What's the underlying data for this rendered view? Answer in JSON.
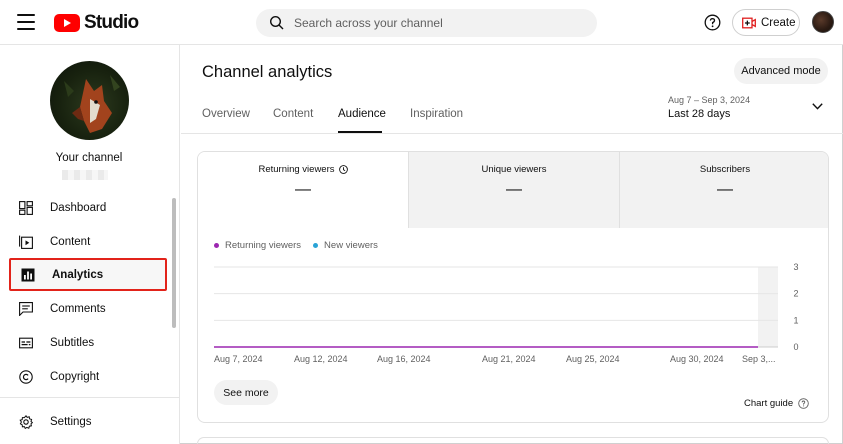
{
  "header": {
    "logo_text": "Studio",
    "search_placeholder": "Search across your channel",
    "create_label": "Create"
  },
  "sidebar": {
    "channel_label": "Your channel",
    "items": [
      {
        "label": "Dashboard",
        "icon": "dashboard-icon"
      },
      {
        "label": "Content",
        "icon": "content-icon"
      },
      {
        "label": "Analytics",
        "icon": "analytics-icon",
        "active": true
      },
      {
        "label": "Comments",
        "icon": "comments-icon"
      },
      {
        "label": "Subtitles",
        "icon": "subtitles-icon"
      },
      {
        "label": "Copyright",
        "icon": "copyright-icon"
      },
      {
        "label": "Settings",
        "icon": "settings-icon"
      }
    ]
  },
  "main": {
    "title": "Channel analytics",
    "advanced_mode_label": "Advanced mode",
    "tabs": [
      {
        "label": "Overview"
      },
      {
        "label": "Content"
      },
      {
        "label": "Audience",
        "active": true
      },
      {
        "label": "Inspiration"
      }
    ],
    "date_range": "Aug 7 – Sep 3, 2024",
    "date_label": "Last 28 days"
  },
  "metrics": [
    {
      "title": "Returning viewers",
      "value": "—",
      "selected": true
    },
    {
      "title": "Unique viewers",
      "value": "—"
    },
    {
      "title": "Subscribers",
      "value": "—"
    }
  ],
  "footer": {
    "see_more_label": "See more",
    "chart_guide_label": "Chart guide"
  },
  "colors": {
    "returning": "#9c27b0",
    "new": "#29a3d6",
    "accent_red": "#ff0000",
    "highlight_border": "#e2231a"
  },
  "chart_data": {
    "type": "line",
    "title": "",
    "xlabel": "",
    "ylabel": "",
    "x_tick_labels": [
      "Aug 7, 2024",
      "Aug 12, 2024",
      "Aug 16, 2024",
      "Aug 21, 2024",
      "Aug 25, 2024",
      "Aug 30, 2024",
      "Sep 3,..."
    ],
    "y_ticks": [
      0,
      1,
      2,
      3
    ],
    "ylim": [
      0,
      3
    ],
    "grid": true,
    "legend": "top-left",
    "series": [
      {
        "name": "Returning viewers",
        "color": "#9c27b0",
        "values": [
          0,
          0,
          0,
          0,
          0,
          0,
          0
        ]
      },
      {
        "name": "New viewers",
        "color": "#29a3d6",
        "values": []
      }
    ]
  }
}
